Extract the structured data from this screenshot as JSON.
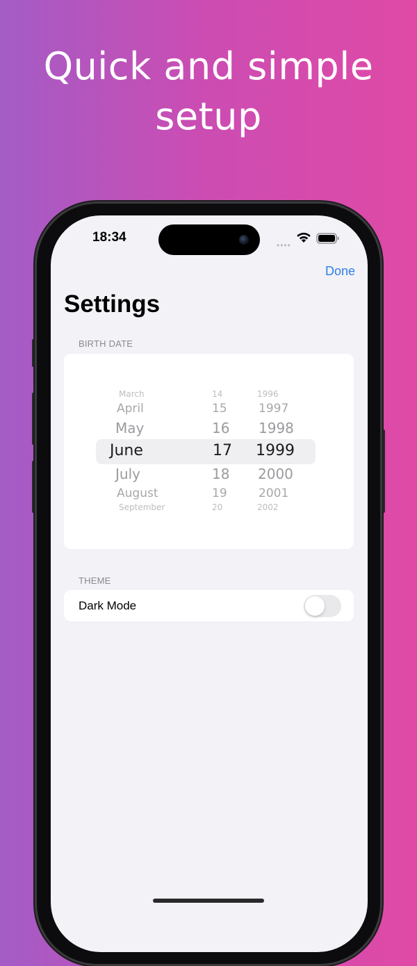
{
  "marketing": {
    "headline_line1": "Quick and simple",
    "headline_line2": "setup"
  },
  "status_bar": {
    "time": "18:34",
    "signal_icon": "signal-dots",
    "wifi_icon": "wifi",
    "battery_icon": "battery-full"
  },
  "nav": {
    "done_label": "Done"
  },
  "page": {
    "title": "Settings"
  },
  "birth_date": {
    "section_label": "BIRTH DATE",
    "months": [
      "March",
      "April",
      "May",
      "June",
      "July",
      "August",
      "September"
    ],
    "days": [
      "14",
      "15",
      "16",
      "17",
      "18",
      "19",
      "20"
    ],
    "years": [
      "1996",
      "1997",
      "1998",
      "1999",
      "2000",
      "2001",
      "2002"
    ],
    "selected": {
      "month": "June",
      "day": "17",
      "year": "1999"
    }
  },
  "theme": {
    "section_label": "THEME",
    "dark_mode_label": "Dark Mode",
    "dark_mode_on": false
  },
  "colors": {
    "accent": "#2f7fe6",
    "gradient_start": "#a45cc6",
    "gradient_end": "#e04aa6",
    "screen_background": "#f2f2f7"
  }
}
